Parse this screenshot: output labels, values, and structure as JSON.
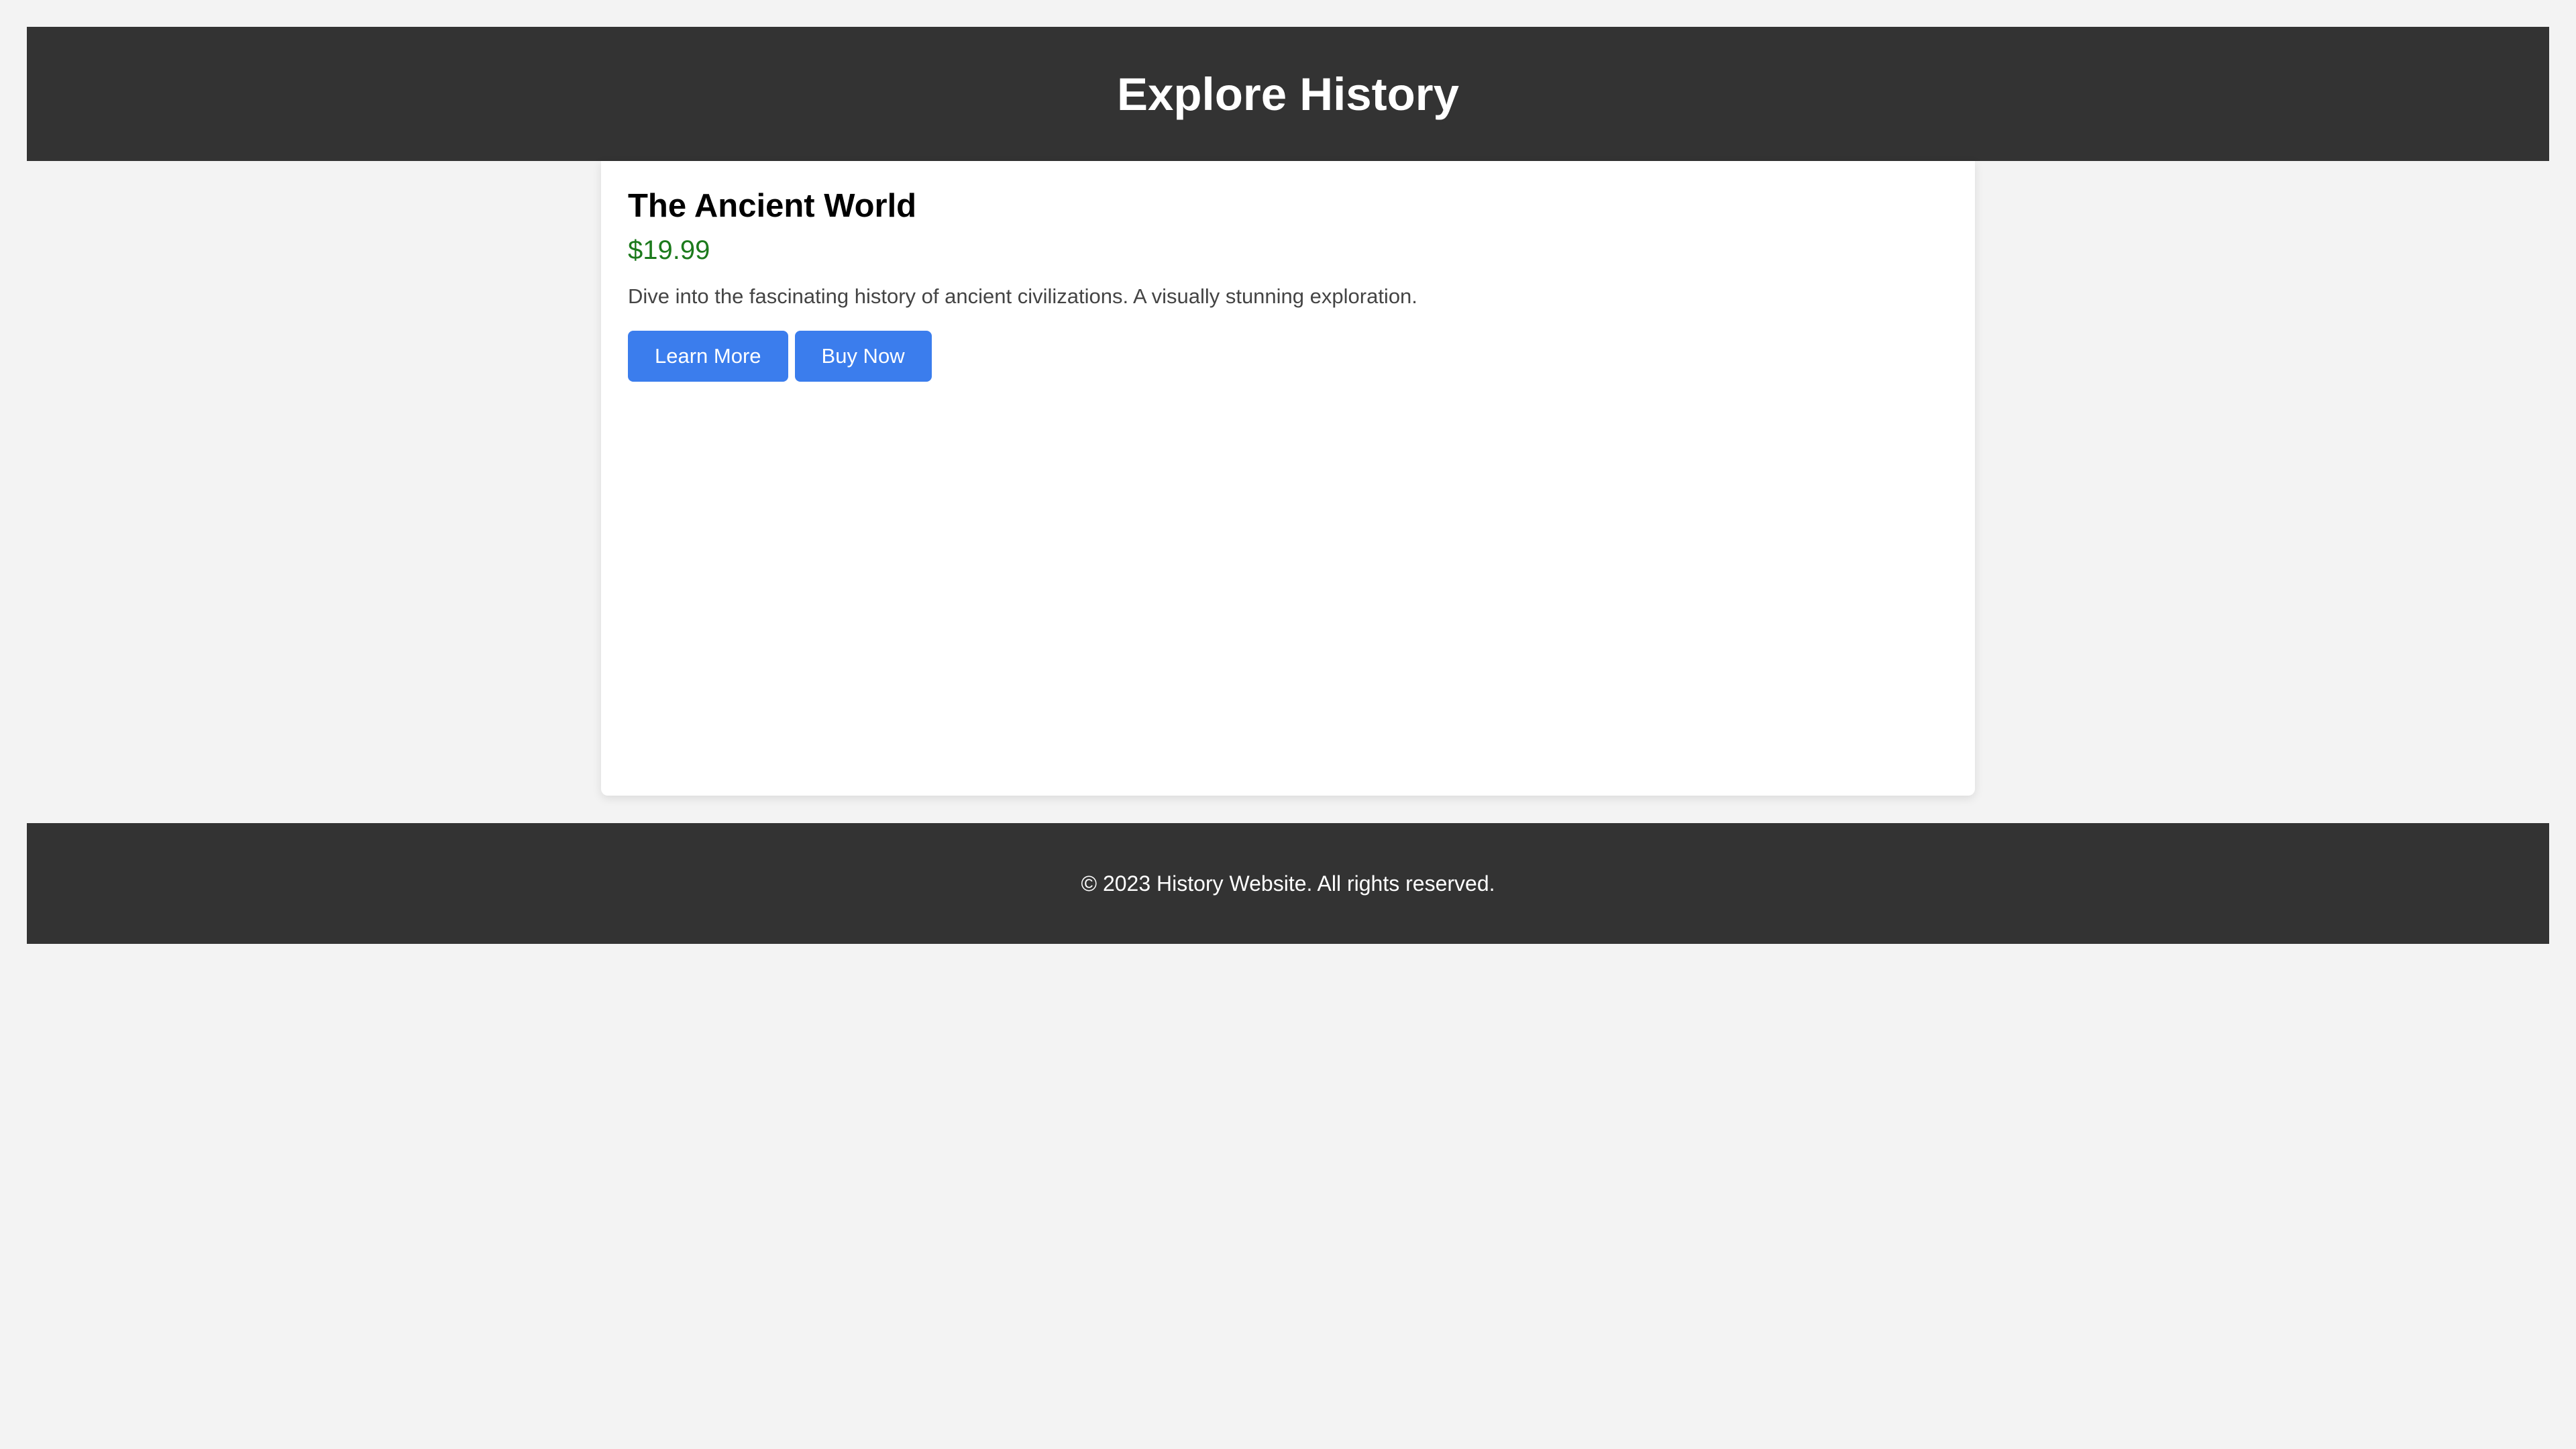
{
  "header": {
    "title": "Explore History"
  },
  "product": {
    "title": "The Ancient World",
    "price": "$19.99",
    "description": "Dive into the fascinating history of ancient civilizations. A visually stunning exploration.",
    "learn_more_label": "Learn More",
    "buy_now_label": "Buy Now"
  },
  "footer": {
    "text": "© 2023 History Website. All rights reserved."
  },
  "colors": {
    "header_background": "#333333",
    "page_background": "#f3f3f3",
    "button_background": "#3b7ded",
    "price_text": "#1c7a1c"
  }
}
